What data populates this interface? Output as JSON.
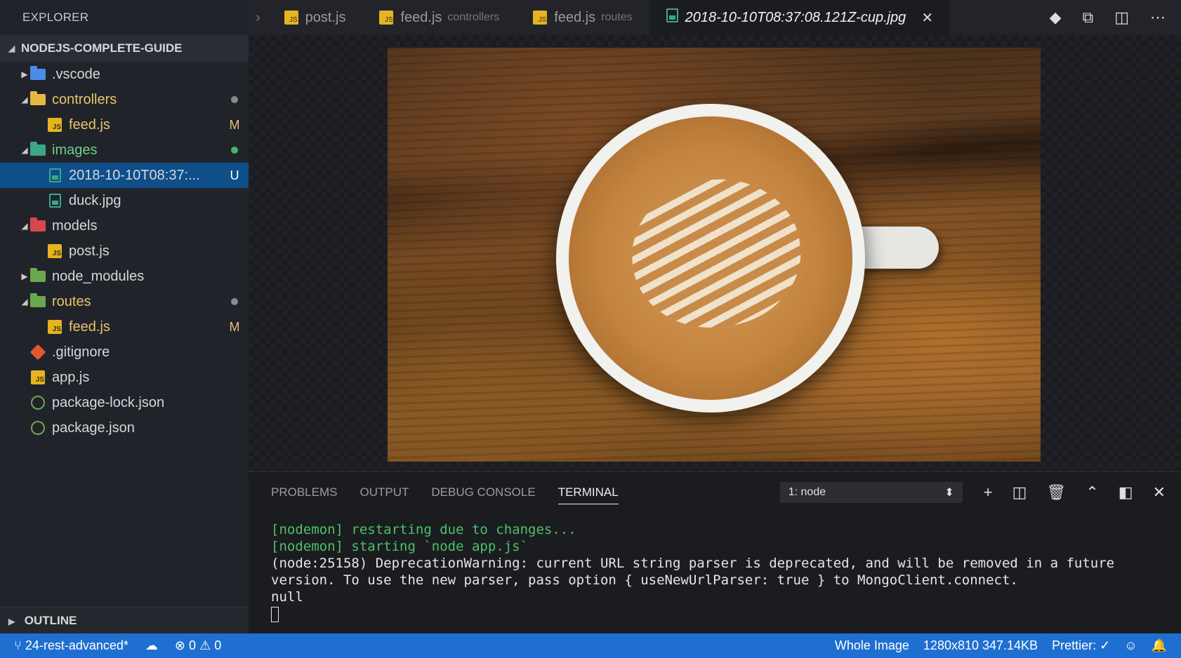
{
  "explorer": {
    "title": "EXPLORER",
    "project": "NODEJS-COMPLETE-GUIDE",
    "outline": "OUTLINE"
  },
  "tree": [
    {
      "label": ".vscode",
      "type": "folder",
      "color": "#4b8de6",
      "expanded": false,
      "depth": 0
    },
    {
      "label": "controllers",
      "type": "folder",
      "color": "#e5b842",
      "expanded": true,
      "depth": 0,
      "dot": "#8a8a8a",
      "text_color": "#e8c56a"
    },
    {
      "label": "feed.js",
      "type": "js",
      "depth": 1,
      "badge": "M",
      "badge_color": "#e1c07a",
      "text_color": "#e8c56a"
    },
    {
      "label": "images",
      "type": "folder",
      "color": "#3aa888",
      "expanded": true,
      "depth": 0,
      "dot": "#49b36b",
      "text_color": "#6ecf88"
    },
    {
      "label": "2018-10-10T08:37:...",
      "type": "img",
      "depth": 1,
      "badge": "U",
      "badge_color": "#ffffff",
      "selected": true
    },
    {
      "label": "duck.jpg",
      "type": "img",
      "depth": 1
    },
    {
      "label": "models",
      "type": "folder",
      "color": "#d9474f",
      "expanded": true,
      "depth": 0
    },
    {
      "label": "post.js",
      "type": "js",
      "depth": 1
    },
    {
      "label": "node_modules",
      "type": "folder",
      "color": "#6aa84f",
      "expanded": false,
      "depth": 0
    },
    {
      "label": "routes",
      "type": "folder",
      "color": "#6aa84f",
      "expanded": true,
      "depth": 0,
      "dot": "#8a8a8a",
      "text_color": "#e8c56a"
    },
    {
      "label": "feed.js",
      "type": "js",
      "depth": 1,
      "badge": "M",
      "badge_color": "#e1c07a",
      "text_color": "#e8c56a"
    },
    {
      "label": ".gitignore",
      "type": "git",
      "depth": 0,
      "noarrow": true
    },
    {
      "label": "app.js",
      "type": "js",
      "depth": 0,
      "noarrow": true
    },
    {
      "label": "package-lock.json",
      "type": "json",
      "depth": 0,
      "noarrow": true
    },
    {
      "label": "package.json",
      "type": "json",
      "depth": 0,
      "noarrow": true
    }
  ],
  "tabs": [
    {
      "label": "post.js",
      "hint": "",
      "type": "js"
    },
    {
      "label": "feed.js",
      "hint": "controllers",
      "type": "js"
    },
    {
      "label": "feed.js",
      "hint": "routes",
      "type": "js"
    },
    {
      "label": "2018-10-10T08:37:08.121Z-cup.jpg",
      "hint": "",
      "type": "img",
      "active": true
    }
  ],
  "tab_close": "✕",
  "tab_actions": [
    "git-compare-icon",
    "open-changes-icon",
    "split-editor-icon",
    "more-icon"
  ],
  "panel": {
    "tabs": [
      "PROBLEMS",
      "OUTPUT",
      "DEBUG CONSOLE",
      "TERMINAL"
    ],
    "active_tab": "TERMINAL",
    "terminal_select": "1: node",
    "terminal_lines": [
      {
        "text": "[nodemon] restarting due to changes...",
        "color": "green"
      },
      {
        "text": "[nodemon] starting `node app.js`",
        "color": "green"
      },
      {
        "text": "(node:25158) DeprecationWarning: current URL string parser is deprecated, and will be removed in a future version. To use the new parser, pass option { useNewUrlParser: true } to MongoClient.connect.",
        "color": "default"
      },
      {
        "text": "null",
        "color": "default"
      }
    ]
  },
  "status": {
    "branch": "24-rest-advanced*",
    "errors": "0",
    "warnings": "0",
    "zoom": "Whole Image",
    "image_info": "1280x810 347.14KB",
    "prettier": "Prettier: ✓"
  },
  "colors": {
    "accent": "#1f6fd0",
    "selection": "#0e4f8a"
  }
}
